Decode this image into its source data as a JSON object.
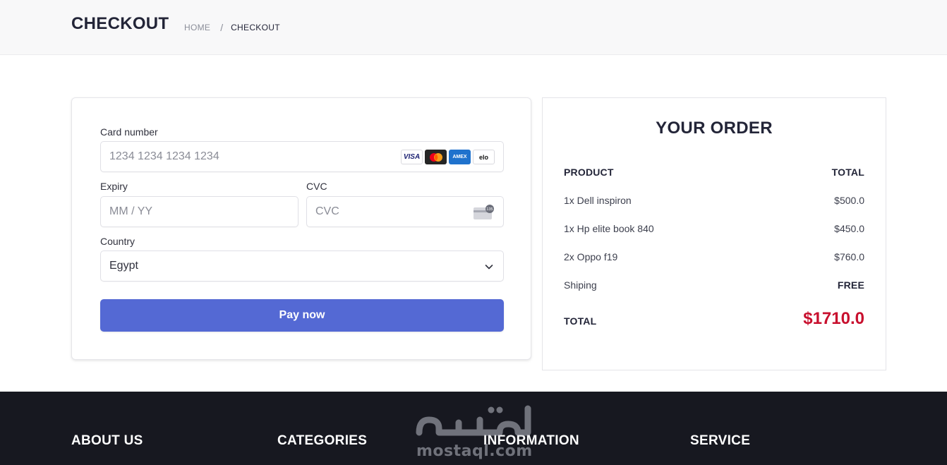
{
  "header": {
    "title": "CHECKOUT",
    "breadcrumb": {
      "home": "HOME",
      "separator": "/",
      "current": "CHECKOUT"
    }
  },
  "payment": {
    "card_number_label": "Card number",
    "card_number_placeholder": "1234 1234 1234 1234",
    "card_brands": [
      "VISA",
      "mastercard",
      "AMEX",
      "elo"
    ],
    "expiry_label": "Expiry",
    "expiry_placeholder": "MM / YY",
    "cvc_label": "CVC",
    "cvc_placeholder": "CVC",
    "cvc_icon_text": "135",
    "country_label": "Country",
    "country_value": "Egypt",
    "pay_button": "Pay now",
    "accent_color": "#5469d4"
  },
  "order": {
    "title": "YOUR ORDER",
    "header": {
      "product": "PRODUCT",
      "total": "TOTAL"
    },
    "items": [
      {
        "name": "1x Dell inspiron",
        "price": "$500.0"
      },
      {
        "name": "1x Hp elite book 840",
        "price": "$450.0"
      },
      {
        "name": "2x Oppo f19",
        "price": "$760.0"
      }
    ],
    "shipping": {
      "label": "Shiping",
      "value": "FREE"
    },
    "total": {
      "label": "TOTAL",
      "value": "$1710.0",
      "color": "#c8102e"
    }
  },
  "footer": {
    "headings": [
      "ABOUT US",
      "CATEGORIES",
      "INFORMATION",
      "SERVICE"
    ],
    "watermark_text": "mostaql.com"
  }
}
